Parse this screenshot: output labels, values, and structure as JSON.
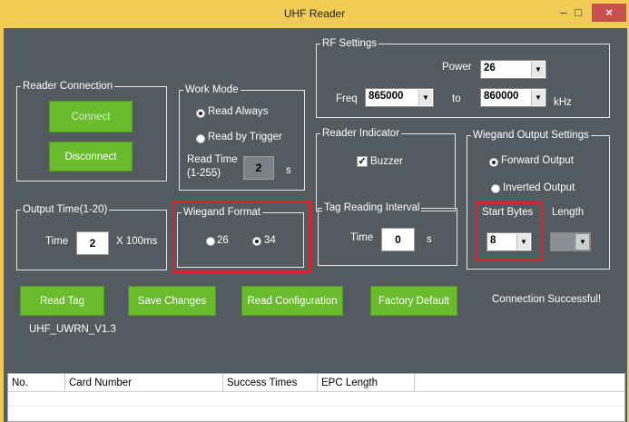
{
  "window": {
    "title": "UHF Reader",
    "minimize_glyph": "–",
    "maximize_glyph": "□",
    "close_glyph": "×"
  },
  "reader_connection": {
    "title": "Reader Connection",
    "connect_label": "Connect",
    "disconnect_label": "Disconnect"
  },
  "work_mode": {
    "title": "Work Mode",
    "read_always_label": "Read Always",
    "read_by_trigger_label": "Read by Trigger",
    "read_time_label_1": "Read Time",
    "read_time_label_2": "(1-255)",
    "read_time_value": "2",
    "read_time_unit": "s",
    "selected": "read_always"
  },
  "rf_settings": {
    "title": "RF Settings",
    "power_label": "Power",
    "power_value": "26",
    "freq_label": "Freq",
    "freq_from": "865000",
    "to_label": "to",
    "freq_to": "860000",
    "unit": "kHz"
  },
  "reader_indicator": {
    "title": "Reader Indicator",
    "buzzer_label": "Buzzer",
    "buzzer_checked": true
  },
  "wiegand_output": {
    "title": "Wiegand Output Settings",
    "forward_label": "Forward Output",
    "inverted_label": "Inverted Output",
    "selected": "forward",
    "start_bytes_label": "Start Bytes",
    "start_bytes_value": "8",
    "length_label": "Length",
    "length_value": ""
  },
  "output_time": {
    "title": "Output Time(1-20)",
    "time_label": "Time",
    "time_value": "2",
    "unit": "X 100ms"
  },
  "wiegand_format": {
    "title": "Wiegand Format",
    "opt1": "26",
    "opt2": "34",
    "selected": "34"
  },
  "tag_interval": {
    "title": "Tag Reading Interval",
    "time_label": "Time",
    "time_value": "0",
    "unit": "s"
  },
  "actions": {
    "read_tag": "Read Tag",
    "save_changes": "Save Changes",
    "read_configuration": "Read Configuration",
    "factory_default": "Factory Default"
  },
  "status": {
    "message": "Connection Successful!",
    "version": "UHF_UWRN_V1.3"
  },
  "table": {
    "columns": [
      "No.",
      "Card Number",
      "Success Times",
      "EPC Length"
    ],
    "rows": []
  },
  "colors": {
    "accent_green": "#6abc2e",
    "panel_bg": "#535b61",
    "highlight_red": "#d9232b",
    "title_bar": "#f2cd55"
  }
}
